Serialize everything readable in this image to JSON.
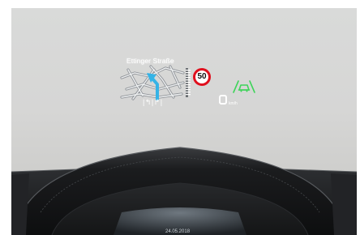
{
  "hud": {
    "street_name": "Ettinger Straße",
    "speed_limit": "50",
    "lane_indicator": "|↰|↱|",
    "speed_unit": "km/h"
  },
  "cluster": {
    "date": "24.05.2018"
  },
  "icons": {
    "navigation_map": "navigation-map-icon",
    "route_arrow": "route-arrow-icon",
    "distance_bar": "distance-bar-icon",
    "adaptive_cruise": "adaptive-cruise-car-icon"
  },
  "colors": {
    "speed_sign_ring": "#e0101e",
    "route_arrow": "#35b3e6",
    "assist_icon": "#3fd45a"
  }
}
